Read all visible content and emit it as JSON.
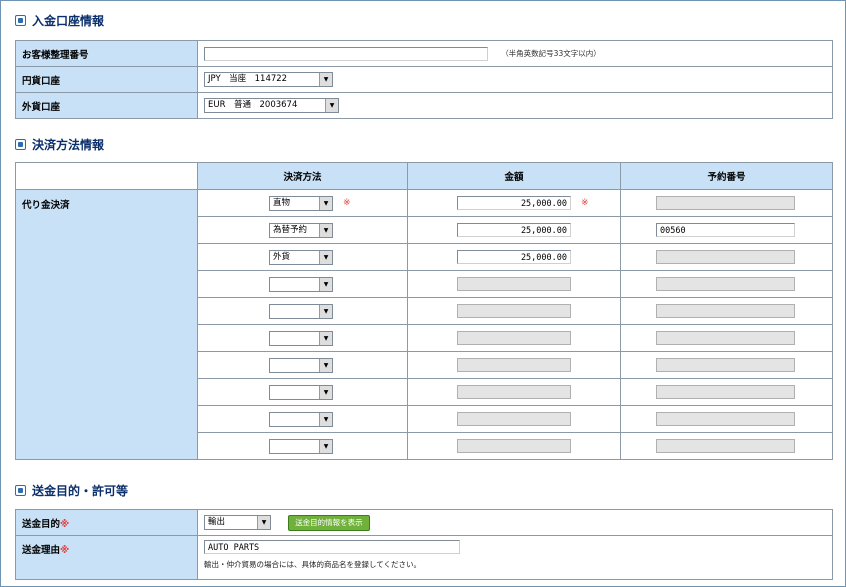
{
  "sections": {
    "deposit_title": "入金口座情報",
    "payment_title": "決済方法情報",
    "purpose_title": "送金目的・許可等"
  },
  "deposit": {
    "customer_no_label": "お客様整理番号",
    "customer_no_value": "",
    "customer_no_hint": "（半角英数記号33文字以内）",
    "yen_label": "円貨口座",
    "yen_value": "JPY　当座　114722",
    "fx_label": "外貨口座",
    "fx_value": "EUR　普通　2003674"
  },
  "payment": {
    "headers": [
      "決済方法",
      "金額",
      "予約番号"
    ],
    "row_label": "代り金決済",
    "required_mark": "※",
    "rows": [
      {
        "method": "直物",
        "amount": "25,000.00",
        "reserve": "",
        "amount_enabled": true,
        "reserve_enabled": false,
        "required": true
      },
      {
        "method": "為替予約",
        "amount": "25,000.00",
        "reserve": "00560",
        "amount_enabled": true,
        "reserve_enabled": true,
        "required": false
      },
      {
        "method": "外貨",
        "amount": "25,000.00",
        "reserve": "",
        "amount_enabled": true,
        "reserve_enabled": false,
        "required": false
      },
      {
        "method": "",
        "amount": "",
        "reserve": "",
        "amount_enabled": false,
        "reserve_enabled": false,
        "required": false
      },
      {
        "method": "",
        "amount": "",
        "reserve": "",
        "amount_enabled": false,
        "reserve_enabled": false,
        "required": false
      },
      {
        "method": "",
        "amount": "",
        "reserve": "",
        "amount_enabled": false,
        "reserve_enabled": false,
        "required": false
      },
      {
        "method": "",
        "amount": "",
        "reserve": "",
        "amount_enabled": false,
        "reserve_enabled": false,
        "required": false
      },
      {
        "method": "",
        "amount": "",
        "reserve": "",
        "amount_enabled": false,
        "reserve_enabled": false,
        "required": false
      },
      {
        "method": "",
        "amount": "",
        "reserve": "",
        "amount_enabled": false,
        "reserve_enabled": false,
        "required": false
      },
      {
        "method": "",
        "amount": "",
        "reserve": "",
        "amount_enabled": false,
        "reserve_enabled": false,
        "required": false
      }
    ]
  },
  "purpose": {
    "purpose_label": "送金目的",
    "purpose_value": "輸出",
    "purpose_button": "送金目的情報を表示",
    "reason_label": "送金理由",
    "reason_value": "AUTO PARTS",
    "reason_note": "輸出・仲介貿易の場合には、具体的商品名を登録してください。",
    "required_mark": "※"
  },
  "colors": {
    "label_bg": "#c8e1f7",
    "section_title": "#0b2f6b",
    "required": "#e2403d",
    "button_green": "#6fb13a"
  }
}
